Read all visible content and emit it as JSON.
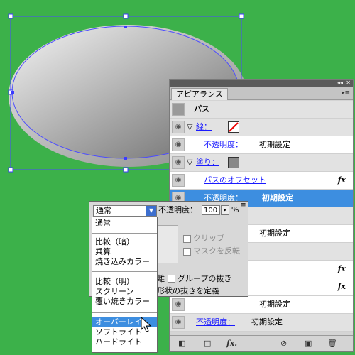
{
  "panel": {
    "tab_label": "アピアランス",
    "menu_icon": "panel-menu-icon",
    "rows": {
      "path_label": "パス",
      "stroke_label": "線：",
      "opacity_1": "不透明度：",
      "default_1": "初期設定",
      "fill_label": "塗り：",
      "offset_label": "パスのオフセット",
      "opacity_2": "不透明度：",
      "default_2": "初期設定",
      "default_3": "初期設定",
      "default_4": "初期設定",
      "opacity_bottom": "不透明度：",
      "default_bottom": "初期設定",
      "fx_label": "fx"
    },
    "footer_icons": [
      "new-stroke-icon",
      "new-fill-icon",
      "add-effect-icon",
      "clear-icon",
      "duplicate-icon",
      "trash-icon"
    ]
  },
  "transparency": {
    "opacity_label": "不透明度：",
    "opacity_value": "100",
    "percent": "%",
    "clip_label": "クリップ",
    "invert_mask_label": "マスクを反転",
    "isolate_label": "離",
    "knockout_label": "グループの抜き",
    "define_knockout_label": "形状の抜きを定義"
  },
  "blend": {
    "selected": "通常",
    "options_group1": [
      "通常"
    ],
    "options_group2": [
      "比較（暗）",
      "乗算",
      "焼き込みカラー"
    ],
    "options_group3": [
      "比較（明）",
      "スクリーン",
      "覆い焼きカラー"
    ],
    "options_group4": [
      "オーバーレイ",
      "ソフトライト",
      "ハードライト"
    ],
    "highlighted": "オーバーレイ"
  }
}
